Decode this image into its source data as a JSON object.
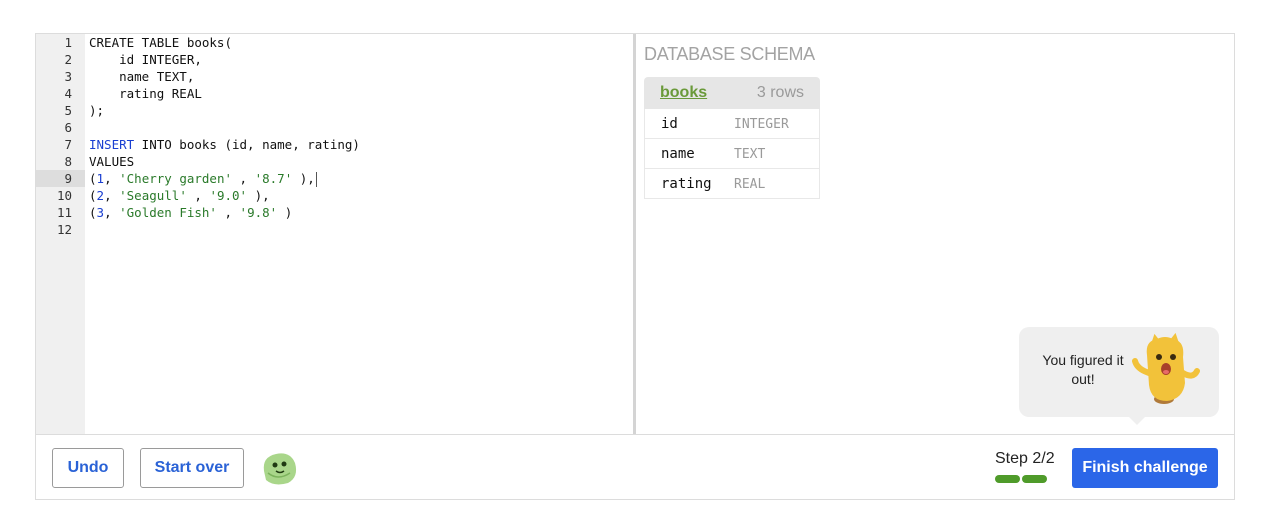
{
  "editor": {
    "line_numbers": [
      "1",
      "2",
      "3",
      "4",
      "5",
      "6",
      "7",
      "8",
      "9",
      "10",
      "11",
      "12"
    ],
    "active_line": 9,
    "lines": [
      [
        {
          "t": "CREATE TABLE books(",
          "c": ""
        }
      ],
      [
        {
          "t": "    id INTEGER,",
          "c": ""
        }
      ],
      [
        {
          "t": "    name TEXT,",
          "c": ""
        }
      ],
      [
        {
          "t": "    rating REAL",
          "c": ""
        }
      ],
      [
        {
          "t": ");",
          "c": ""
        }
      ],
      [
        {
          "t": "",
          "c": ""
        }
      ],
      [
        {
          "t": "INSERT",
          "c": "kw"
        },
        {
          "t": " INTO books (id, name, rating)",
          "c": ""
        }
      ],
      [
        {
          "t": "VALUES",
          "c": ""
        }
      ],
      [
        {
          "t": "(",
          "c": ""
        },
        {
          "t": "1",
          "c": "num"
        },
        {
          "t": ", ",
          "c": ""
        },
        {
          "t": "'Cherry garden'",
          "c": "str"
        },
        {
          "t": " , ",
          "c": ""
        },
        {
          "t": "'8.7'",
          "c": "str"
        },
        {
          "t": " ),",
          "c": ""
        }
      ],
      [
        {
          "t": "(",
          "c": ""
        },
        {
          "t": "2",
          "c": "num"
        },
        {
          "t": ", ",
          "c": ""
        },
        {
          "t": "'Seagull'",
          "c": "str"
        },
        {
          "t": " , ",
          "c": ""
        },
        {
          "t": "'9.0'",
          "c": "str"
        },
        {
          "t": " ),",
          "c": ""
        }
      ],
      [
        {
          "t": "(",
          "c": ""
        },
        {
          "t": "3",
          "c": "num"
        },
        {
          "t": ", ",
          "c": ""
        },
        {
          "t": "'Golden Fish'",
          "c": "str"
        },
        {
          "t": " , ",
          "c": ""
        },
        {
          "t": "'9.8'",
          "c": "str"
        },
        {
          "t": " )",
          "c": ""
        }
      ],
      [
        {
          "t": "",
          "c": ""
        }
      ]
    ]
  },
  "schema": {
    "title": "DATABASE SCHEMA",
    "table": {
      "name": "books",
      "rows_label": "3 rows",
      "columns": [
        {
          "name": "id",
          "type": "INTEGER"
        },
        {
          "name": "name",
          "type": "TEXT"
        },
        {
          "name": "rating",
          "type": "REAL"
        }
      ]
    }
  },
  "bubble": {
    "text": "You figured it out!"
  },
  "footer": {
    "undo_label": "Undo",
    "start_over_label": "Start over",
    "step_label": "Step 2/2",
    "steps_completed": 2,
    "steps_total": 2,
    "finish_label": "Finish challenge"
  },
  "colors": {
    "accent": "#2b66e8",
    "progress": "#4f9b2a",
    "keyword": "#1a3fd1",
    "string": "#2a7a2a",
    "table_name": "#6a9a3a"
  }
}
